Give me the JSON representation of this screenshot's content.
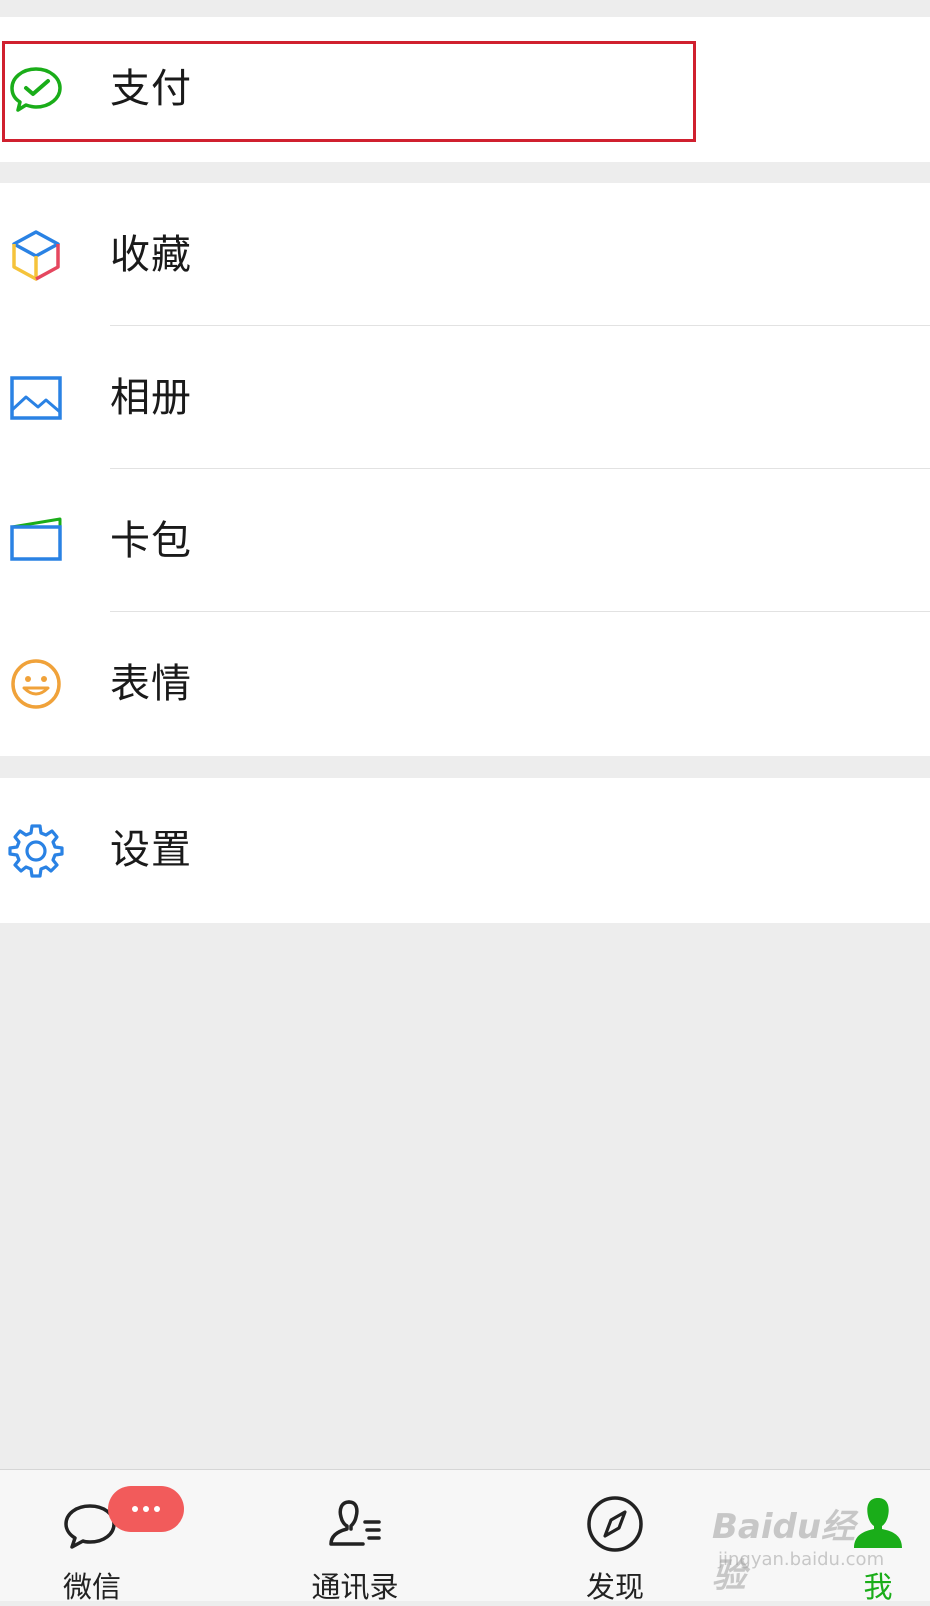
{
  "menu": {
    "payment": {
      "label": "支付",
      "icon": "wechat-pay-icon",
      "color": "#1aad19"
    },
    "favorites": {
      "label": "收藏",
      "icon": "cube-icon"
    },
    "album": {
      "label": "相册",
      "icon": "picture-icon",
      "color": "#2a82e4"
    },
    "cards": {
      "label": "卡包",
      "icon": "card-icon",
      "color": "#2a82e4"
    },
    "stickers": {
      "label": "表情",
      "icon": "smiley-icon",
      "color": "#f0a23a"
    },
    "settings": {
      "label": "设置",
      "icon": "gear-icon",
      "color": "#2a82e4"
    }
  },
  "tabbar": {
    "tabs": [
      {
        "label": "微信",
        "icon": "chat-bubble-icon"
      },
      {
        "label": "通讯录",
        "icon": "contacts-icon"
      },
      {
        "label": "发现",
        "icon": "compass-icon"
      },
      {
        "label": "我",
        "icon": "person-icon",
        "active": true
      }
    ],
    "active_color": "#1aad19"
  },
  "highlight_color": "#d0202f",
  "watermark": {
    "line1": "Baidu经验",
    "line2": "jingyan.baidu.com"
  }
}
